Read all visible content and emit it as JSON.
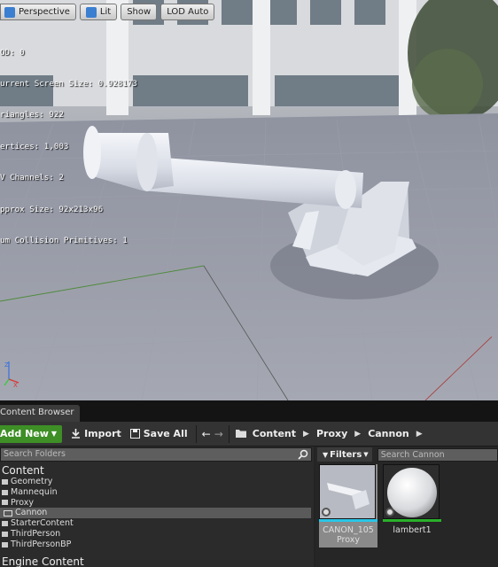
{
  "viewport": {
    "toolbar": {
      "perspective": "Perspective",
      "lit": "Lit",
      "show": "Show",
      "lod": "LOD Auto"
    },
    "stats": [
      "OD: 0",
      "urrent Screen Size: 0.928173",
      "riangles: 922",
      "ertices: 1,003",
      "V Channels: 2",
      "pprox Size: 92x213x96",
      "um Collision Primitives: 1"
    ]
  },
  "content_browser": {
    "tab_label": "Content Browser",
    "add_new": "Add New",
    "import": "Import",
    "save_all": "Save All",
    "breadcrumb": [
      "Content",
      "Proxy",
      "Cannon"
    ],
    "search_folders_placeholder": "Search Folders",
    "tree": {
      "root": "Content",
      "items": [
        "Geometry",
        "Mannequin",
        "Proxy",
        "Cannon",
        "StarterContent",
        "ThirdPerson",
        "ThirdPersonBP"
      ],
      "selected": "Cannon",
      "engine_root": "Engine Content"
    },
    "filters_label": "Filters",
    "search_assets_placeholder": "Search Cannon",
    "assets": [
      {
        "name": "CANON_105 Proxy",
        "type_color": "#28c6e8"
      },
      {
        "name": "lambert1",
        "type_color": "#2ab02a"
      }
    ]
  }
}
